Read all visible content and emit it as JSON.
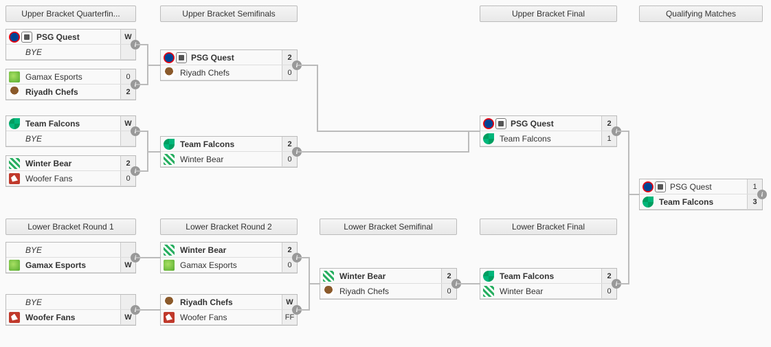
{
  "headers": {
    "uqf": "Upper Bracket Quarterfin...",
    "usf": "Upper Bracket Semifinals",
    "ubf": "Upper Bracket Final",
    "qm": "Qualifying Matches",
    "lr1": "Lower Bracket Round 1",
    "lr2": "Lower Bracket Round 2",
    "lsf": "Lower Bracket Semifinal",
    "lbf": "Lower Bracket Final"
  },
  "teams": {
    "psg": "PSG Quest",
    "gamax": "Gamax Esports",
    "chefs": "Riyadh Chefs",
    "falcons": "Team Falcons",
    "winter": "Winter Bear",
    "woofer": "Woofer Fans",
    "bye": "BYE"
  },
  "matches": {
    "uqf1": {
      "t1": "psg",
      "s1": "W",
      "t2": "bye",
      "s2": "",
      "w": 1
    },
    "uqf2": {
      "t1": "gamax",
      "s1": "0",
      "t2": "chefs",
      "s2": "2",
      "w": 2
    },
    "uqf3": {
      "t1": "falcons",
      "s1": "W",
      "t2": "bye",
      "s2": "",
      "w": 1
    },
    "uqf4": {
      "t1": "winter",
      "s1": "2",
      "t2": "woofer",
      "s2": "0",
      "w": 1
    },
    "usf1": {
      "t1": "psg",
      "s1": "2",
      "t2": "chefs",
      "s2": "0",
      "w": 1
    },
    "usf2": {
      "t1": "falcons",
      "s1": "2",
      "t2": "winter",
      "s2": "0",
      "w": 1
    },
    "ubf": {
      "t1": "psg",
      "s1": "2",
      "t2": "falcons",
      "s2": "1",
      "w": 1
    },
    "lr1a": {
      "t1": "bye",
      "s1": "",
      "t2": "gamax",
      "s2": "W",
      "w": 2
    },
    "lr1b": {
      "t1": "bye",
      "s1": "",
      "t2": "woofer",
      "s2": "W",
      "w": 2
    },
    "lr2a": {
      "t1": "winter",
      "s1": "2",
      "t2": "gamax",
      "s2": "0",
      "w": 1
    },
    "lr2b": {
      "t1": "chefs",
      "s1": "W",
      "t2": "woofer",
      "s2": "FF",
      "w": 1
    },
    "lsf": {
      "t1": "winter",
      "s1": "2",
      "t2": "chefs",
      "s2": "0",
      "w": 1
    },
    "lbf": {
      "t1": "falcons",
      "s1": "2",
      "t2": "winter",
      "s2": "0",
      "w": 1
    },
    "qm": {
      "t1": "psg",
      "s1": "1",
      "t2": "falcons",
      "s2": "3",
      "w": 2
    }
  },
  "icons": {
    "psg": [
      "psg1",
      "psg2"
    ],
    "gamax": [
      "gamax"
    ],
    "chefs": [
      "chefs"
    ],
    "falcons": [
      "falcons"
    ],
    "winter": [
      "winter"
    ],
    "woofer": [
      "woofer"
    ],
    "bye": []
  }
}
